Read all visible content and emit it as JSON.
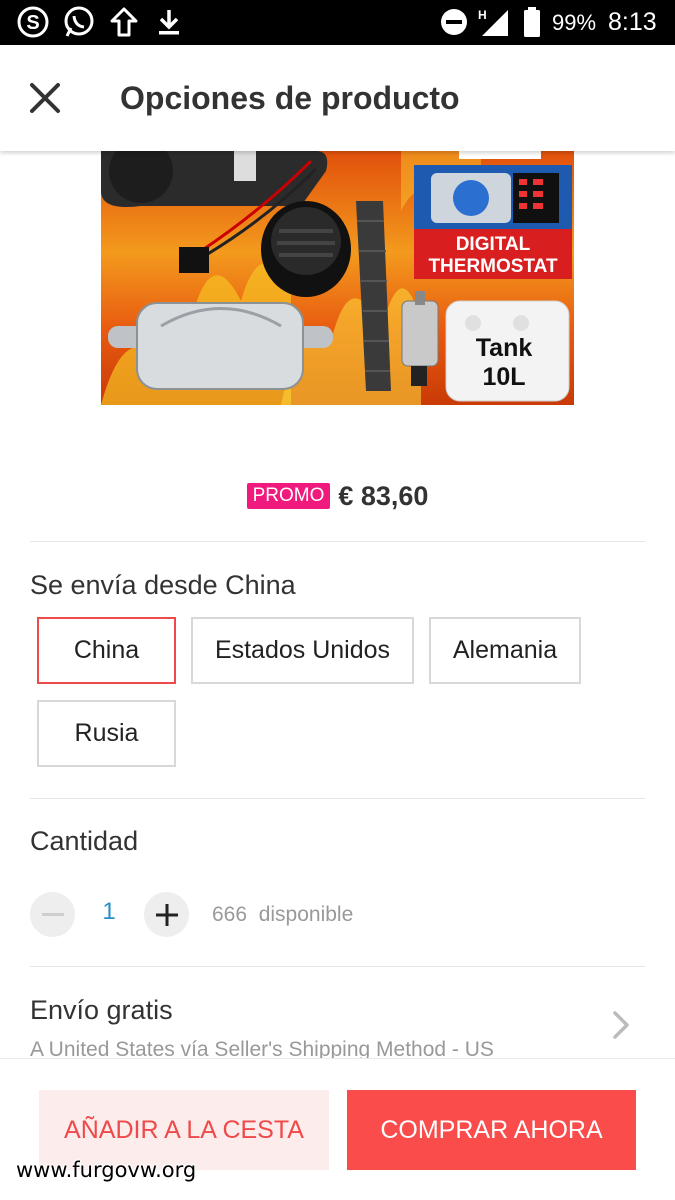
{
  "status_bar": {
    "time": "8:13",
    "battery_percent": "99%",
    "network_type": "H",
    "left_icons": [
      "skype-icon",
      "whatsapp-icon",
      "upload-icon",
      "download-icon"
    ],
    "right_icons": [
      "do-not-disturb-icon",
      "signal-icon",
      "battery-icon"
    ]
  },
  "header": {
    "title": "Opciones de producto",
    "close_icon": "close-icon"
  },
  "product_image": {
    "labels": [
      "DIGITAL",
      "THERMOSTAT",
      "Tank",
      "10L"
    ]
  },
  "price": {
    "promo_label": "PROMO",
    "amount": "€ 83,60"
  },
  "ships_from": {
    "title": "Se envía desde China",
    "options": [
      "China",
      "Estados Unidos",
      "Alemania",
      "Rusia"
    ],
    "selected": "China"
  },
  "quantity": {
    "title": "Cantidad",
    "value": "1",
    "stock": "666  disponible"
  },
  "shipping": {
    "title": "Envío gratis",
    "subtitle": "A United States vía Seller's Shipping Method - US"
  },
  "actions": {
    "add_to_cart": "AÑADIR A LA CESTA",
    "buy_now": "COMPRAR AHORA"
  },
  "watermark": "www.furgovw.org",
  "colors": {
    "accent": "#fb4c4c",
    "promo": "#f0197d",
    "selected_border": "#ef4a4a",
    "quantity_value": "#2b8fc7"
  }
}
